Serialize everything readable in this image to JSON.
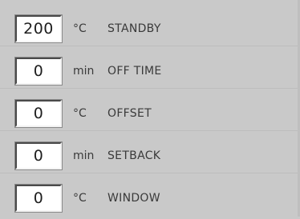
{
  "settings": [
    {
      "value": "200",
      "unit": "°C",
      "label": "STANDBY"
    },
    {
      "value": "0",
      "unit": "min",
      "label": "OFF TIME"
    },
    {
      "value": "0",
      "unit": "°C",
      "label": "OFFSET"
    },
    {
      "value": "0",
      "unit": "min",
      "label": "SETBACK"
    },
    {
      "value": "0",
      "unit": "°C",
      "label": "WINDOW"
    }
  ]
}
